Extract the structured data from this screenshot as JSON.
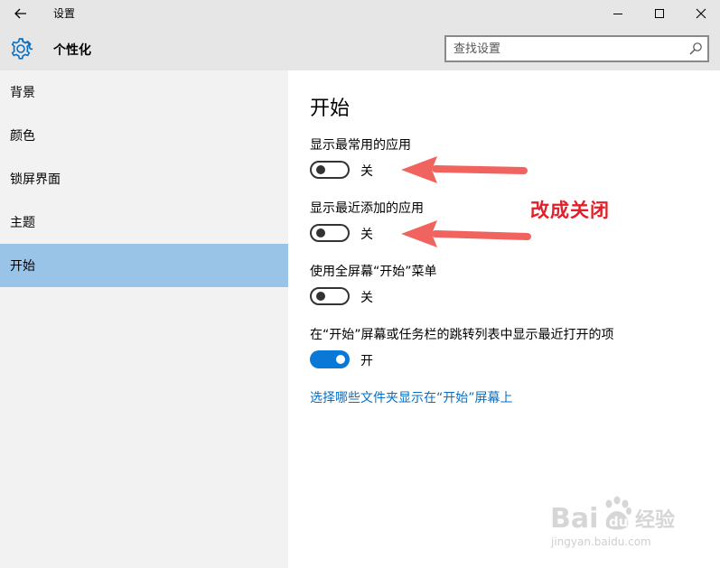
{
  "window": {
    "title": "设置",
    "back_icon": "arrow-left-icon",
    "controls": [
      "minimize-icon",
      "maximize-icon",
      "close-icon"
    ]
  },
  "header": {
    "icon": "gear-icon",
    "title": "个性化",
    "search": {
      "placeholder": "查找设置",
      "value": "",
      "icon": "search-icon"
    }
  },
  "sidebar": {
    "items": [
      {
        "label": "背景",
        "selected": false
      },
      {
        "label": "颜色",
        "selected": false
      },
      {
        "label": "锁屏界面",
        "selected": false
      },
      {
        "label": "主题",
        "selected": false
      },
      {
        "label": "开始",
        "selected": true
      }
    ],
    "selected_color": "#99c4e8"
  },
  "main": {
    "title": "开始",
    "settings": [
      {
        "label": "显示最常用的应用",
        "state": "关",
        "on": false
      },
      {
        "label": "显示最近添加的应用",
        "state": "关",
        "on": false
      },
      {
        "label": "使用全屏幕“开始”菜单",
        "state": "关",
        "on": false
      },
      {
        "label": "在“开始”屏幕或任务栏的跳转列表中显示最近打开的项",
        "state": "开",
        "on": true
      }
    ],
    "link": "选择哪些文件夹显示在“开始”屏幕上"
  },
  "annotation": {
    "text": "改成关闭",
    "color": "#e0202a",
    "arrow_color": "#f0635f"
  },
  "watermark": {
    "logo": "Bai du 经验",
    "url": "jingyan.baidu.com"
  },
  "colors": {
    "accent": "#0a78d7",
    "link": "#0a6fc2",
    "titlebar": "#e6e6e6",
    "sidebar": "#f2f2f2"
  }
}
